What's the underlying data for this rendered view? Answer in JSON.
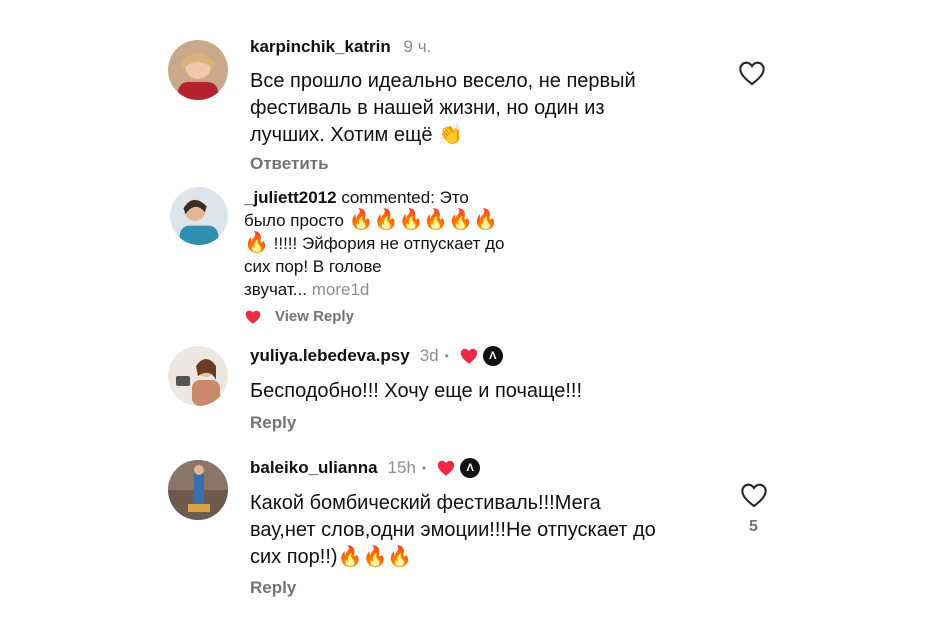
{
  "comments": [
    {
      "username": "karpinchik_katrin",
      "time": "9 ч.",
      "lines": [
        "Все прошло идеально весело, не первый",
        "фестиваль в нашей жизни, но один из",
        "лучших. Хотим ещё"
      ],
      "emoji": "👏",
      "reply_label": "Ответить"
    },
    {
      "username": "_juliett2012",
      "commented_label": "commented: Это",
      "lines": [
        "было просто",
        "!!!!! Эйфория не отпускает до",
        "сих пор! В голове",
        "звучат..."
      ],
      "more_label": "more",
      "time": "1d",
      "reply_label": "View Reply"
    },
    {
      "username": "yuliya.lebedeva.psy",
      "time": "3d",
      "dot": "•",
      "lines": [
        "Бесподобно!!! Хочу еще и почаще!!!"
      ],
      "reply_label": "Reply"
    },
    {
      "username": "baleiko_ulianna",
      "time": "15h",
      "dot": "•",
      "lines": [
        "Какой бомбический фестиваль!!!Мега",
        "вау,нет слов,одни эмоции!!!Не отпускает до",
        "сих пор!!)"
      ],
      "like_count": "5",
      "reply_label": "Reply"
    }
  ],
  "icons": {
    "fire": "🔥",
    "creator_badge_letter": "Λ"
  },
  "colors": {
    "heart_red": "#ed2b45",
    "meta_gray": "#8e8e8e"
  }
}
